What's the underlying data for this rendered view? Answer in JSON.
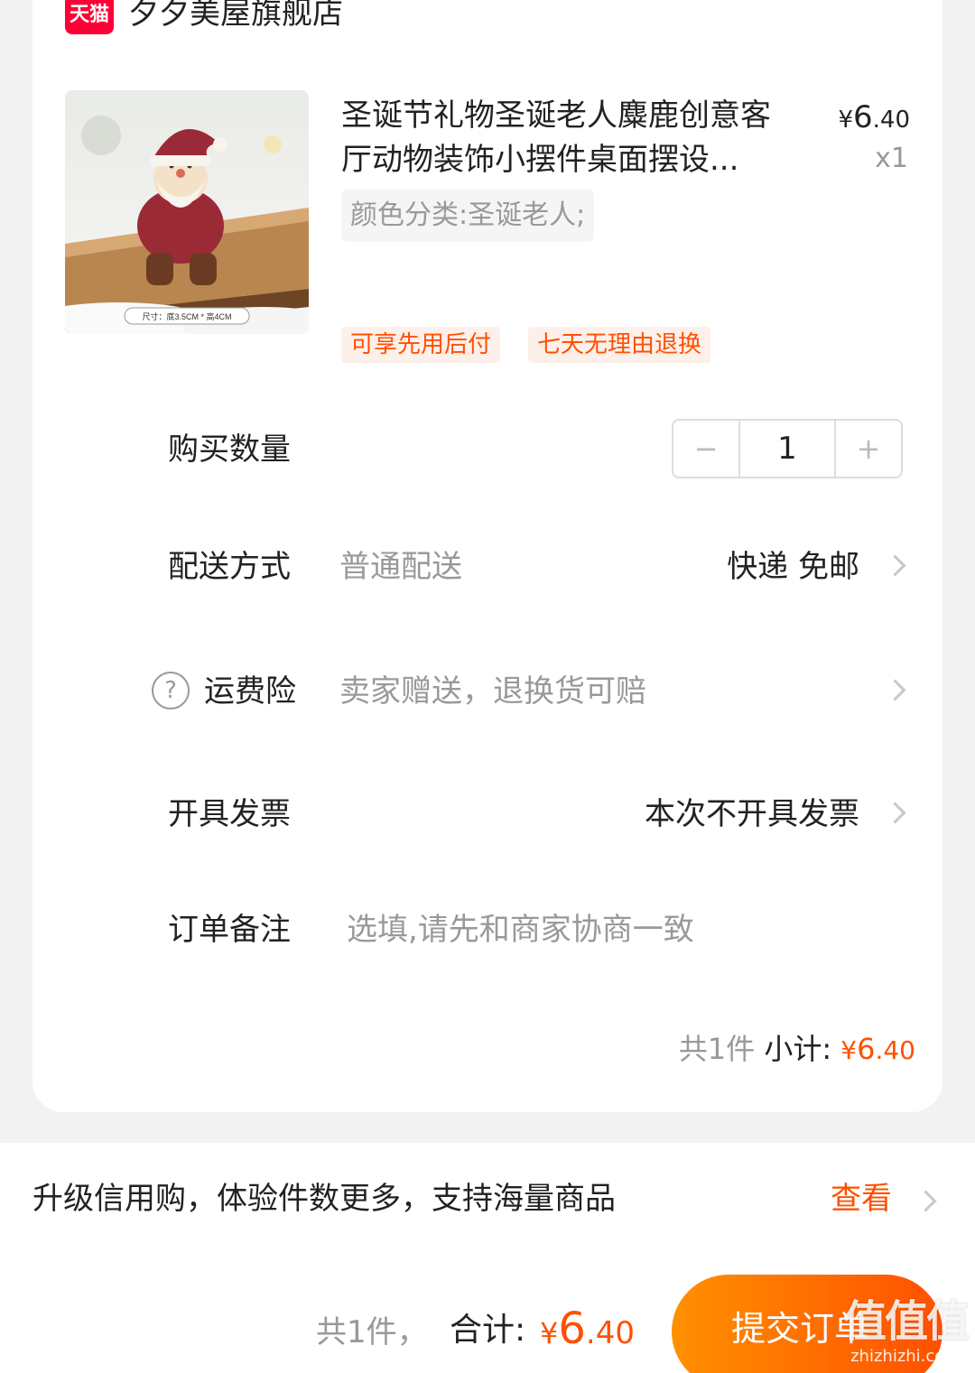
{
  "store": {
    "badge": "天猫",
    "name": "夕夕美屋旗舰店"
  },
  "product": {
    "image_caption": "尺寸：底3.5CM * 高4CM",
    "title": "圣诞节礼物圣诞老人麋鹿创意客厅动物装饰小摆件桌面摆设...",
    "price_symbol": "¥",
    "price_int": "6",
    "price_dec": ".40",
    "quantity_label": "x1",
    "sku": "颜色分类:圣诞老人;",
    "tags": [
      "可享先用后付",
      "七天无理由退换"
    ]
  },
  "quantity_row": {
    "label": "购买数量",
    "minus": "−",
    "value": "1",
    "plus": "+"
  },
  "delivery_row": {
    "label": "配送方式",
    "sub": "普通配送",
    "value": "快递 免邮"
  },
  "insurance_row": {
    "help_icon": "?",
    "label": "运费险",
    "sub": "卖家赠送，退换货可赔"
  },
  "invoice_row": {
    "label": "开具发票",
    "value": "本次不开具发票"
  },
  "note_row": {
    "label": "订单备注",
    "placeholder": "选填,请先和商家协商一致"
  },
  "subtotal": {
    "count": "共1件",
    "label": "小计:",
    "symbol": "¥",
    "int": "6",
    "dec": ".40"
  },
  "promo": {
    "text": "升级信用购，体验件数更多，支持海量商品",
    "link": "查看"
  },
  "footer": {
    "count": "共1件，",
    "total_label": "合计:",
    "symbol": "¥",
    "int": "6",
    "dec": ".40",
    "submit": "提交订单"
  },
  "watermark": {
    "main": "值值值",
    "sub": "zhizhizhi.com"
  },
  "colors": {
    "accent": "#ff5000",
    "tmall": "#ff0036"
  }
}
